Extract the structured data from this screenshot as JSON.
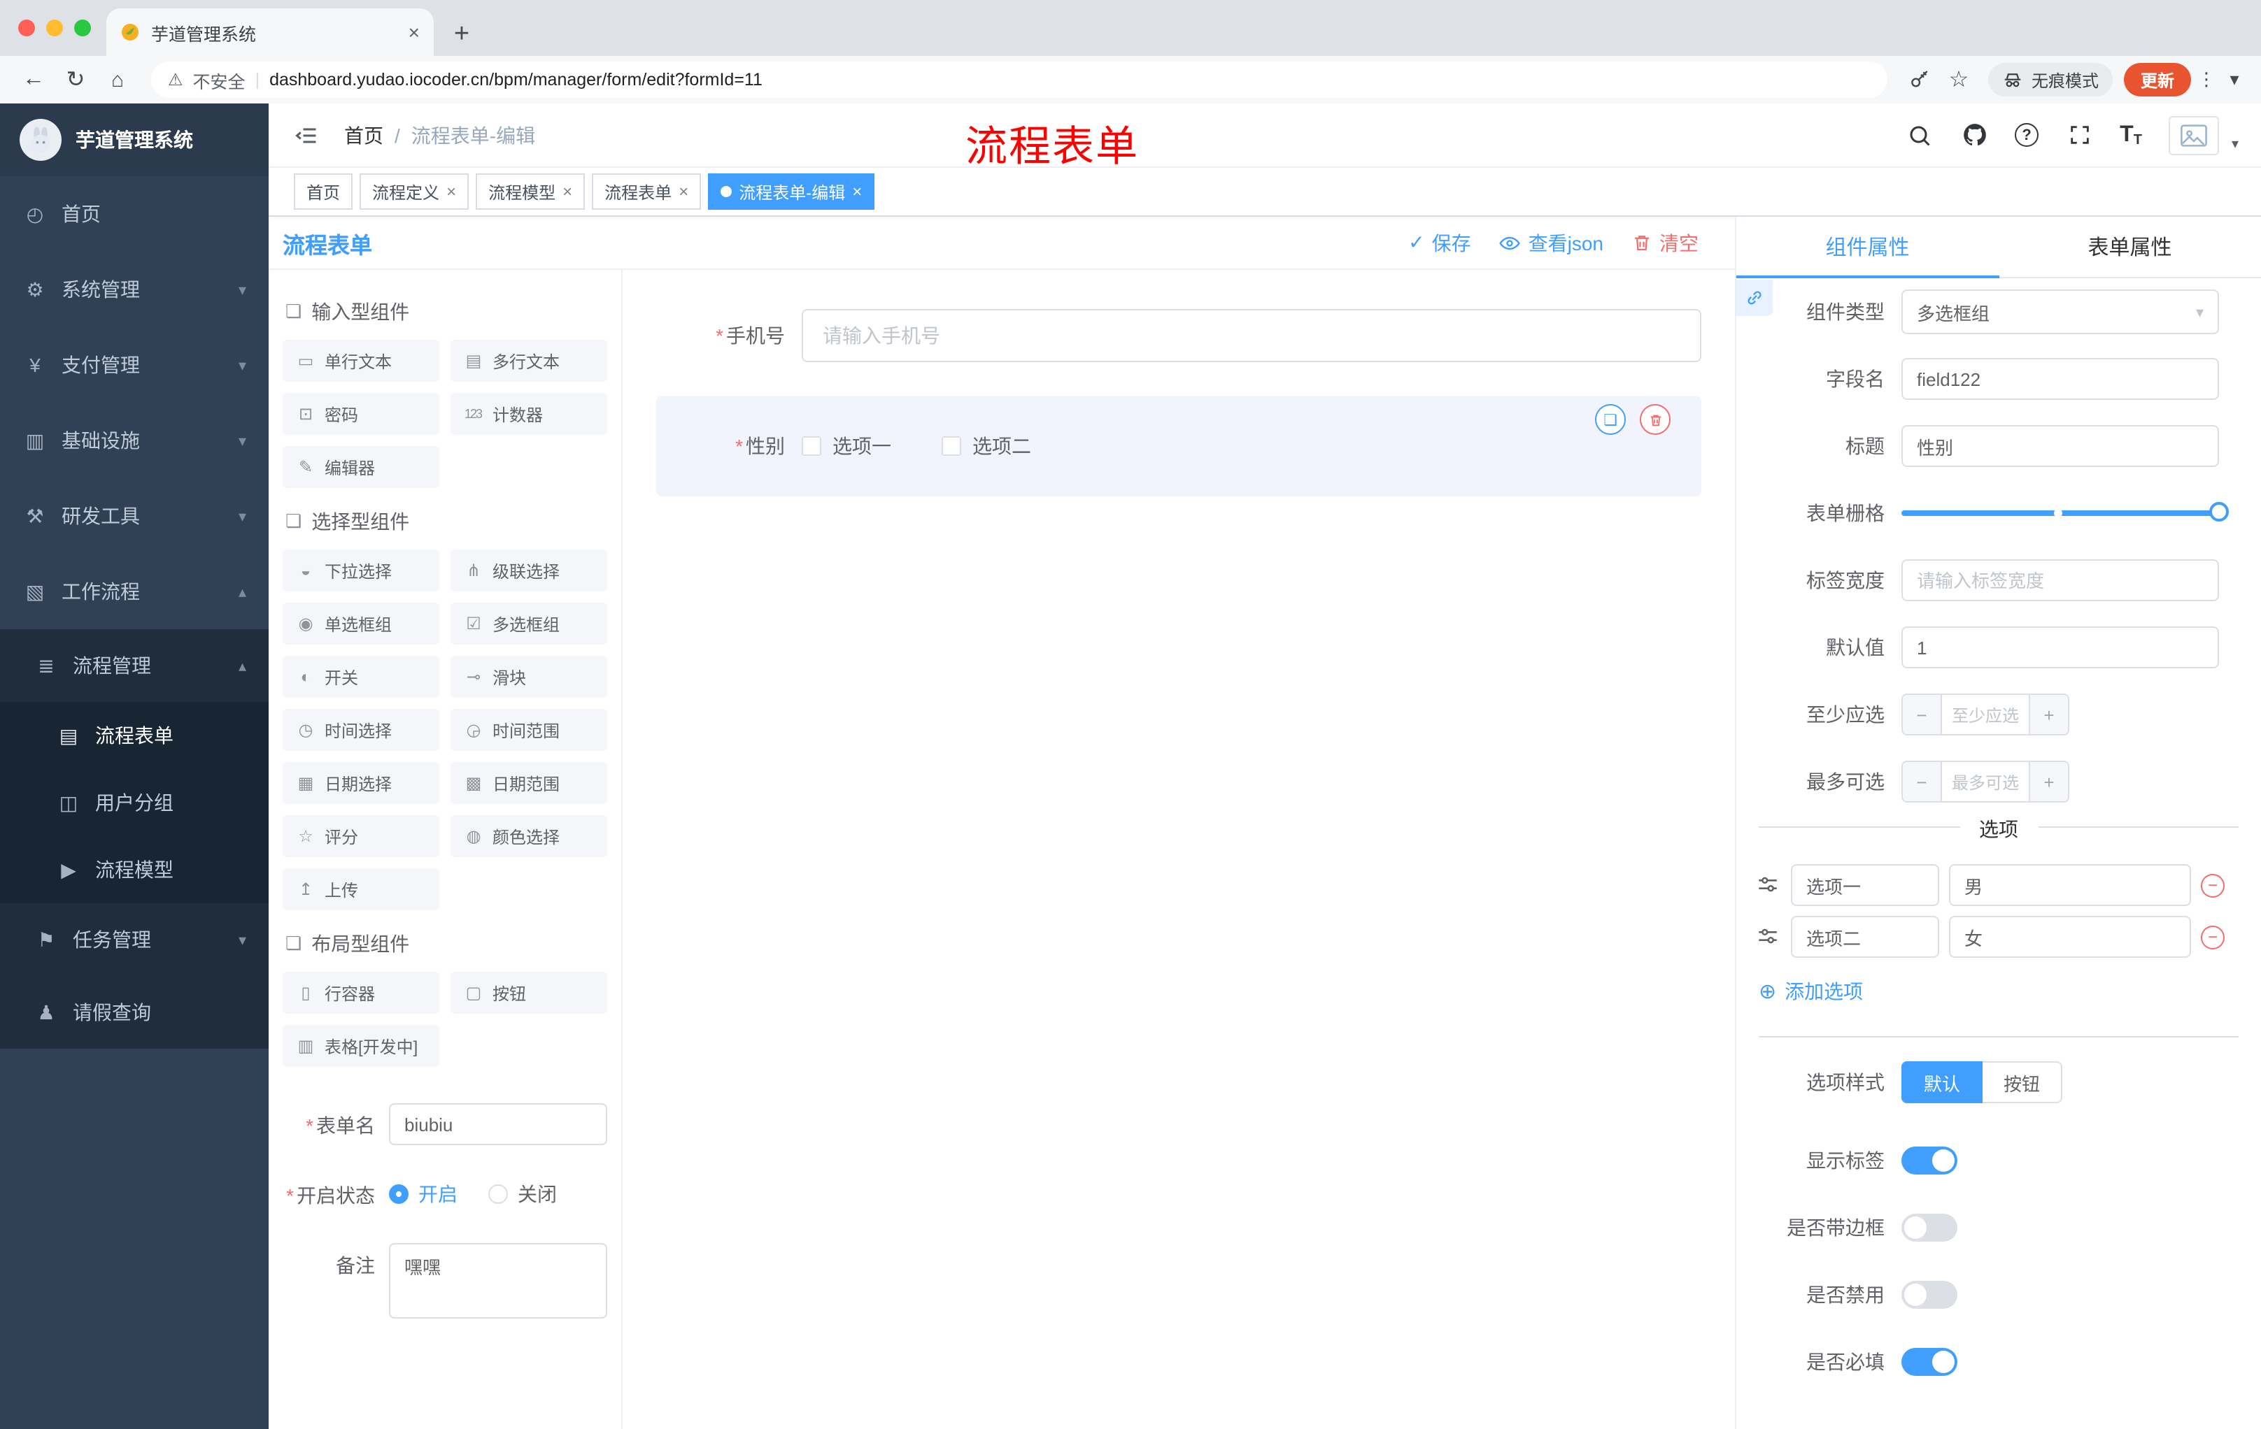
{
  "colors": {
    "accent": "#409EFF",
    "danger": "#F56C6C",
    "sidebar_bg": "#304156",
    "sidebar_sub_bg": "#1f2d3d",
    "tag_active": "#409EFF",
    "update_pill": "#e8542f",
    "annotation_red": "#ff0000"
  },
  "glyphs": {
    "close": "×",
    "plus": "+",
    "minus": "−",
    "check": "✓",
    "question": "?",
    "required": "*",
    "breadcrumb_sep": "/",
    "chevron_down": "▾",
    "chevron_up": "▴",
    "select_caret": "▾",
    "back": "←",
    "reload": "↻",
    "home": "⌂",
    "warning": "⚠",
    "pipe": "|",
    "star": "☆",
    "ellipsis": "⋮",
    "copy": "❏",
    "add": "⊕",
    "letter_t": "T"
  },
  "browser": {
    "tab_title": "芋道管理系统",
    "security_label": "不安全",
    "url": "dashboard.yudao.iocoder.cn/bpm/manager/form/edit?formId=11",
    "incognito_label": "无痕模式",
    "update_label": "更新"
  },
  "sidebar": {
    "logo_title": "芋道管理系统",
    "items": [
      {
        "icon": "◴",
        "label": "首页"
      },
      {
        "icon": "⚙",
        "label": "系统管理"
      },
      {
        "icon": "¥",
        "label": "支付管理"
      },
      {
        "icon": "▥",
        "label": "基础设施"
      },
      {
        "icon": "⚒",
        "label": "研发工具"
      },
      {
        "icon": "▧",
        "label": "工作流程"
      }
    ],
    "submenu": {
      "process_mgmt": {
        "icon": "≣",
        "label": "流程管理"
      },
      "children": [
        {
          "icon": "▤",
          "label": "流程表单"
        },
        {
          "icon": "◫",
          "label": "用户分组"
        },
        {
          "icon": "▶",
          "label": "流程模型"
        }
      ],
      "task_mgmt": {
        "icon": "⚑",
        "label": "任务管理"
      },
      "leave_query": {
        "icon": "♟",
        "label": "请假查询"
      }
    }
  },
  "header": {
    "breadcrumb_home": "首页",
    "breadcrumb_current": "流程表单-编辑",
    "annotation": "流程表单"
  },
  "tags": [
    {
      "label": "首页"
    },
    {
      "label": "流程定义"
    },
    {
      "label": "流程模型"
    },
    {
      "label": "流程表单"
    },
    {
      "label": "流程表单-编辑"
    }
  ],
  "designer": {
    "title": "流程表单",
    "toolbar": {
      "save": "保存",
      "view_json": "查看json",
      "clear": "清空"
    },
    "palette": {
      "group1": {
        "icon": "❏",
        "title": "输入型组件",
        "items": [
          {
            "icon": "▭",
            "label": "单行文本"
          },
          {
            "icon": "▤",
            "label": "多行文本"
          },
          {
            "icon": "⊡",
            "label": "密码"
          },
          {
            "icon": "123",
            "label": "计数器"
          },
          {
            "icon": "✎",
            "label": "编辑器"
          }
        ]
      },
      "group2": {
        "icon": "❏",
        "title": "选择型组件",
        "items": [
          {
            "icon": "◒",
            "label": "下拉选择"
          },
          {
            "icon": "⋔",
            "label": "级联选择"
          },
          {
            "icon": "◉",
            "label": "单选框组"
          },
          {
            "icon": "☑",
            "label": "多选框组"
          },
          {
            "icon": "◐",
            "label": "开关"
          },
          {
            "icon": "⊸",
            "label": "滑块"
          },
          {
            "icon": "◷",
            "label": "时间选择"
          },
          {
            "icon": "◶",
            "label": "时间范围"
          },
          {
            "icon": "▦",
            "label": "日期选择"
          },
          {
            "icon": "▩",
            "label": "日期范围"
          },
          {
            "icon": "☆",
            "label": "评分"
          },
          {
            "icon": "◍",
            "label": "颜色选择"
          },
          {
            "icon": "↥",
            "label": "上传"
          }
        ]
      },
      "group3": {
        "icon": "❏",
        "title": "布局型组件",
        "items": [
          {
            "icon": "▯",
            "label": "行容器"
          },
          {
            "icon": "▢",
            "label": "按钮"
          },
          {
            "icon": "▥",
            "label": "表格[开发中]"
          }
        ]
      }
    },
    "meta": {
      "name_label": "表单名",
      "name_value": "biubiu",
      "status_label": "开启状态",
      "status_on": "开启",
      "status_off": "关闭",
      "remark_label": "备注",
      "remark_value": "嘿嘿"
    },
    "canvas": {
      "phone_label": "手机号",
      "phone_placeholder": "请输入手机号",
      "gender_label": "性别",
      "gender_options": [
        {
          "label": "选项一"
        },
        {
          "label": "选项二"
        }
      ]
    }
  },
  "props": {
    "tab_component": "组件属性",
    "tab_form": "表单属性",
    "component_type_label": "组件类型",
    "component_type_value": "多选框组",
    "field_name_label": "字段名",
    "field_name_value": "field122",
    "title_label": "标题",
    "title_value": "性别",
    "grid_label": "表单栅格",
    "label_width_label": "标签宽度",
    "label_width_placeholder": "请输入标签宽度",
    "default_label": "默认值",
    "default_value": "1",
    "min_label": "至少应选",
    "min_placeholder": "至少应选",
    "max_label": "最多可选",
    "max_placeholder": "最多可选",
    "options_title": "选项",
    "options": [
      {
        "label": "选项一",
        "value": "男"
      },
      {
        "label": "选项二",
        "value": "女"
      }
    ],
    "add_option": "添加选项",
    "style_label": "选项样式",
    "style_default": "默认",
    "style_button": "按钮",
    "switch_show_label": "显示标签",
    "switch_border": "是否带边框",
    "switch_disabled": "是否禁用",
    "switch_required": "是否必填"
  }
}
